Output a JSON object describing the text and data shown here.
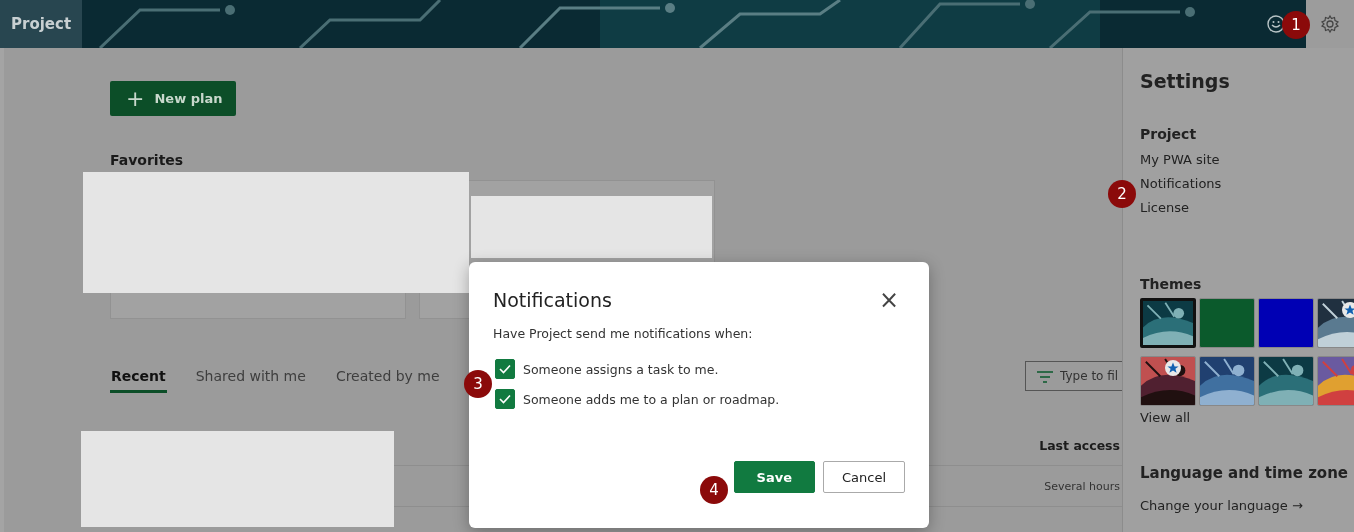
{
  "header": {
    "app_name": "Project"
  },
  "main": {
    "new_plan_button": {
      "icon": "+",
      "label": "New plan"
    },
    "favorites_title": "Favorites",
    "tabs": [
      {
        "label": "Recent",
        "selected": true
      },
      {
        "label": "Shared with me",
        "selected": false
      },
      {
        "label": "Created by me",
        "selected": false
      }
    ],
    "filter": {
      "placeholder": "Type to fil"
    },
    "table": {
      "columns": [
        "Last access"
      ],
      "rows": [
        [
          "Several hours"
        ]
      ]
    }
  },
  "settings": {
    "title": "Settings",
    "project_heading": "Project",
    "links": [
      "My PWA site",
      "Notifications",
      "License"
    ],
    "themes_heading": "Themes",
    "themes": [
      {
        "kind": "picture",
        "selected": true,
        "starred": false
      },
      {
        "kind": "color",
        "color": "#0b5a2c",
        "selected": false,
        "starred": false
      },
      {
        "kind": "color",
        "color": "#0000b4",
        "selected": false,
        "starred": false
      },
      {
        "kind": "picture",
        "selected": false,
        "starred": true
      },
      {
        "kind": "picture",
        "selected": false,
        "starred": true
      },
      {
        "kind": "picture",
        "selected": false,
        "starred": false
      },
      {
        "kind": "picture",
        "selected": false,
        "starred": false
      },
      {
        "kind": "picture",
        "selected": false,
        "starred": false
      }
    ],
    "view_all": "View all",
    "language_heading": "Language and time zone",
    "change_language": "Change your language →"
  },
  "dialog": {
    "title": "Notifications",
    "close": "×",
    "intro": "Have Project send me notifications when:",
    "options": [
      {
        "label": "Someone assigns a task to me.",
        "checked": true
      },
      {
        "label": "Someone adds me to a plan or roadmap.",
        "checked": true
      }
    ],
    "buttons": [
      "Save",
      "Cancel"
    ]
  },
  "steps": [
    "1",
    "2",
    "3",
    "4"
  ]
}
